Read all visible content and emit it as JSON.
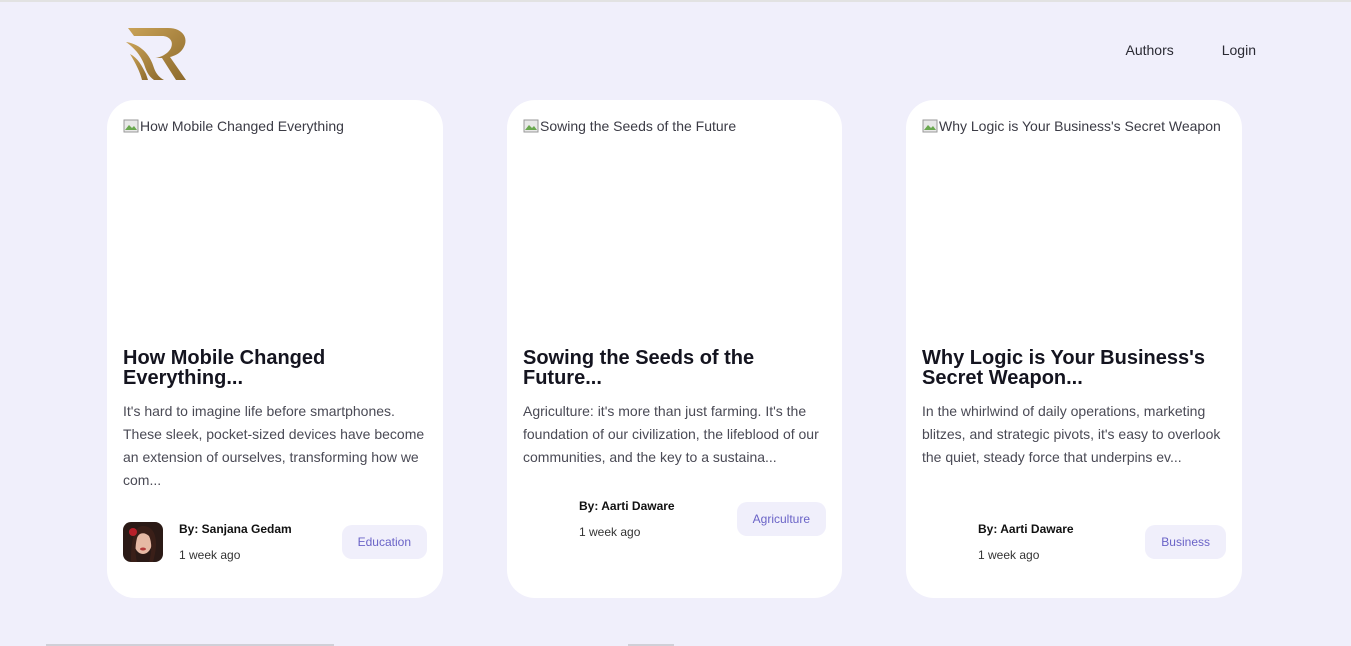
{
  "header": {
    "nav": [
      "Authors",
      "Login"
    ]
  },
  "posts": [
    {
      "image_alt": "How Mobile Changed Everything",
      "title": "How Mobile Changed Everything...",
      "excerpt": "It's hard to imagine life before smartphones. These sleek, pocket-sized devices have become an extension of ourselves, transforming how we com...",
      "author": "By: Sanjana Gedam",
      "time": "1 week ago",
      "category": "Education",
      "has_avatar": true
    },
    {
      "image_alt": "Sowing the Seeds of the Future",
      "title": "Sowing the Seeds of the Future...",
      "excerpt": "Agriculture: it's more than just farming. It's the foundation of our civilization, the lifeblood of our communities, and the key to a sustaina...",
      "author": "By: Aarti Daware",
      "time": "1 week ago",
      "category": "Agriculture",
      "has_avatar": false
    },
    {
      "image_alt": "Why Logic is Your Business's Secret Weapon",
      "title": "Why Logic is Your Business's Secret Weapon...",
      "excerpt": "In the whirlwind of daily operations, marketing blitzes, and strategic pivots, it's easy to overlook the quiet, steady force that underpins ev...",
      "author": "By: Aarti Daware",
      "time": "1 week ago",
      "category": "Business",
      "has_avatar": false
    }
  ],
  "colors": {
    "background": "#f0effb",
    "tag_text": "#6a63c7",
    "logo_gold": "#b08a3e"
  }
}
